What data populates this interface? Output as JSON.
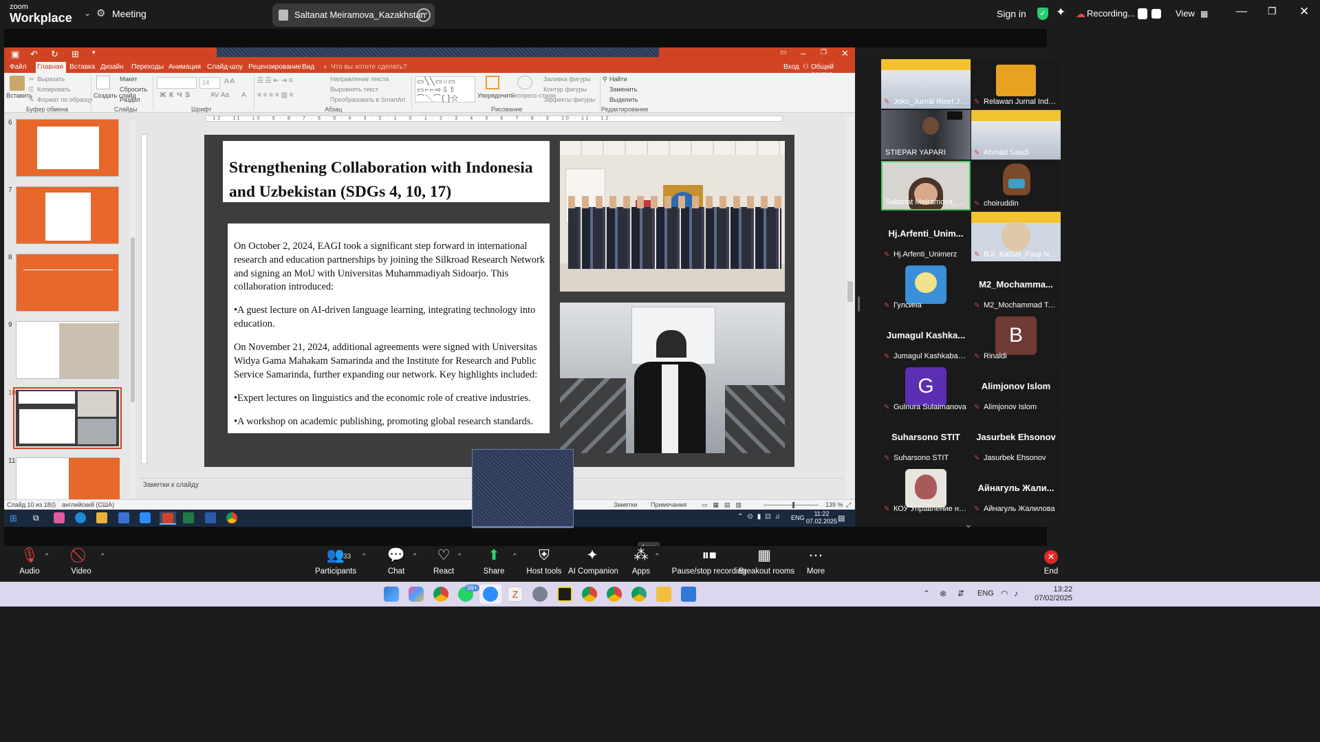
{
  "zoom_top": {
    "brand_top": "zoom",
    "brand_bottom": "Workplace",
    "meeting_label": "Meeting",
    "shared_by": "Saltanat Meiramova_Kazakhstan",
    "sign_in": "Sign in",
    "recording": "Recording...",
    "view": "View"
  },
  "ppt": {
    "tabs": [
      "Файл",
      "Главная",
      "Вставка",
      "Дизайн",
      "Переходы",
      "Анимация",
      "Слайд-шоу",
      "Рецензирование",
      "Вид"
    ],
    "tell_me": "Что вы хотите сделать?",
    "sign_in": "Вход",
    "share": "Общий доступ",
    "ribbon": {
      "paste": "Вставить",
      "cut": "Вырезать",
      "copy": "Копировать",
      "format_painter": "Формат по образцу",
      "clipboard_group": "Буфер обмена",
      "new_slide": "Создать слайд",
      "layout": "Макет",
      "reset": "Сбросить",
      "section": "Раздел",
      "slides_group": "Слайды",
      "font_size": "14",
      "font_group": "Шрифт",
      "text_direction": "Направление текста",
      "align_text": "Выровнять текст",
      "smartart": "Преобразовать в SmartArt",
      "paragraph_group": "Абзац",
      "arrange": "Упорядочить",
      "quick_styles": "Экспресс-стили",
      "shape_fill": "Заливка фигуры",
      "shape_outline": "Контур фигуры",
      "shape_effects": "Эффекты фигуры",
      "drawing_group": "Рисование",
      "find": "Найти",
      "replace": "Заменить",
      "select": "Выделить",
      "editing_group": "Редактирование"
    },
    "thumb_numbers": [
      "6",
      "7",
      "8",
      "9",
      "10",
      "11"
    ],
    "notes": "Заметки к слайду",
    "status": {
      "slide_info": "Слайд 10 из 18",
      "language": "английский (США)",
      "notes_btn": "Заметки",
      "comments_btn": "Примечания",
      "zoom": "139 %"
    }
  },
  "slide": {
    "title": "Strengthening Collaboration with Indonesia and Uzbekistan (SDGs 4, 10, 17)",
    "p1": "On October 2, 2024, EAGI took a significant step forward in international research and education partnerships by joining the Silkroad Research Network and signing an MoU with Universitas Muhammadiyah Sidoarjo. This collaboration introduced:",
    "p2": "•A guest lecture on AI-driven language learning, integrating technology into education.",
    "p3": "On November 21, 2024, additional agreements were signed with Universitas Widya Gama Mahakam Samarinda and the Institute for Research and Public Service Samarinda, further expanding our network. Key highlights included:",
    "p4": "•Expert lectures on linguistics and the economic role of creative industries.",
    "p5": "•A workshop on academic publishing, promoting global research standards."
  },
  "inner_taskbar": {
    "language": "ENG",
    "time": "11:22",
    "date": "07.02.2025"
  },
  "gallery": [
    {
      "name": "Joko_Jurnal Riset Jak...",
      "kind": "video"
    },
    {
      "name": "Relawan Jurnal Indon...",
      "kind": "video"
    },
    {
      "name": "STIEPAR YAPARI",
      "kind": "video"
    },
    {
      "name": "Ahmad Saudi",
      "kind": "video"
    },
    {
      "name": "Saltanat Meiramova_Kaz...",
      "kind": "video"
    },
    {
      "name": "choiruddin",
      "kind": "avatar"
    },
    {
      "name": "Hj.Arfenti_Unimerz",
      "big": "Hj.Arfenti_Unim...",
      "kind": "text"
    },
    {
      "name": "RJI_KalSel_Fauji Nurdin",
      "kind": "avatar"
    },
    {
      "name": "Гулсина",
      "kind": "avatar"
    },
    {
      "name": "M2_Mochammad Tan...",
      "big": "M2_Mochamma...",
      "kind": "text"
    },
    {
      "name": "Jumagul Kashkabaeva",
      "big": "Jumagul Kashka...",
      "kind": "text"
    },
    {
      "name": "Rinaldi",
      "letter": "B",
      "kind": "letter"
    },
    {
      "name": "Gulnura Sulaimanova",
      "letter": "G",
      "kind": "letter"
    },
    {
      "name": "Alimjonov Islom",
      "big": "Alimjonov Islom",
      "kind": "text"
    },
    {
      "name": "Suharsono STIT",
      "big": "Suharsono STIT",
      "kind": "text"
    },
    {
      "name": "Jasurbek Ehsonov",
      "big": "Jasurbek Ehsonov",
      "kind": "text"
    },
    {
      "name": "КОУ Управление нау...",
      "kind": "avatar"
    },
    {
      "name": "Айнагуль Жалилова",
      "big": "Айнагуль Жали...",
      "kind": "text"
    }
  ],
  "zoom_bottom": {
    "audio": "Audio",
    "video": "Video",
    "participants": "Participants",
    "participants_count": "33",
    "chat": "Chat",
    "react": "React",
    "share": "Share",
    "host_tools": "Host tools",
    "ai_companion": "AI Companion",
    "apps": "Apps",
    "apps_tooltip": "Apps",
    "pause_recording": "Pause/stop recording",
    "breakout": "Breakout rooms",
    "more": "More",
    "end": "End"
  },
  "host_taskbar": {
    "badge": "99+",
    "language": "ENG",
    "time": "13:22",
    "date": "07/02/2025"
  },
  "colors": {
    "ppt_accent": "#d04423",
    "thumb_orange": "#e8672a",
    "zoom_bg": "#1c1c1c",
    "recording_red": "#e74c3c",
    "shield_green": "#2ecc71"
  }
}
